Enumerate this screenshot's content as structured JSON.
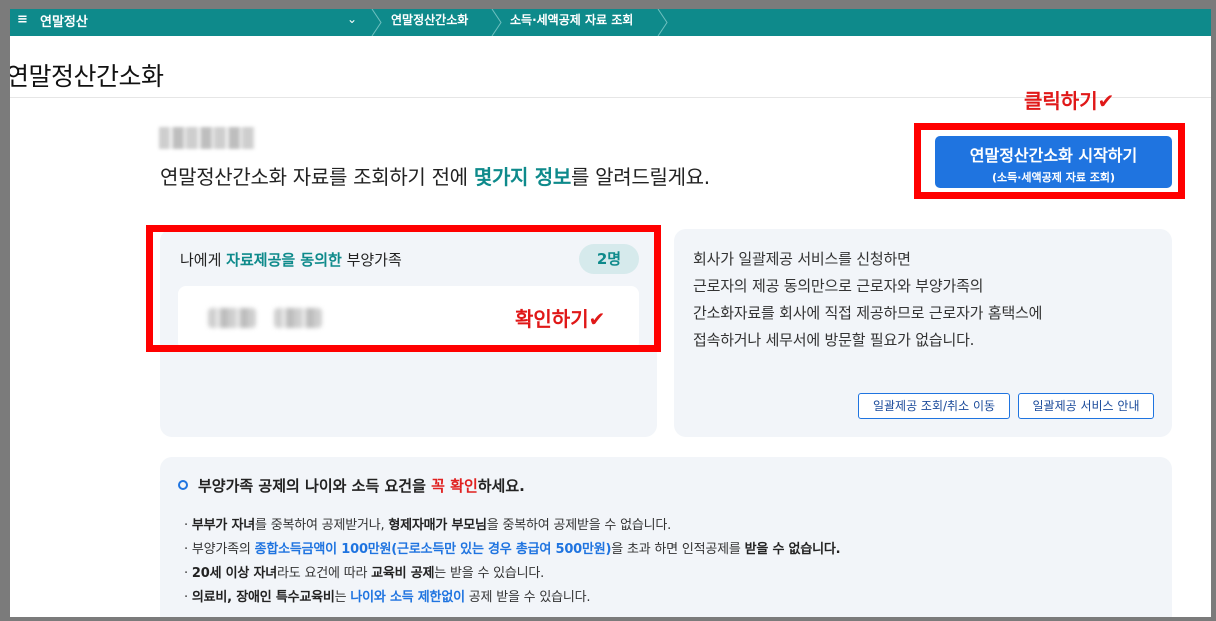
{
  "topbar": {
    "menu_icon": "hamburger-icon",
    "menu_glyph": "≡",
    "title": "연말정산",
    "chevron_glyph": "⌄",
    "breadcrumb": [
      "연말정산간소화",
      "소득·세액공제 자료 조회"
    ]
  },
  "page_title": "연말정산간소화",
  "intro": {
    "before": "연말정산간소화 자료를 조회하기 전에 ",
    "highlight": "몇가지 정보",
    "after": "를 알려드릴게요."
  },
  "annotations": {
    "click": "클릭하기✔",
    "confirm": "확인하기✔",
    "color": "#ff0000"
  },
  "start_button": {
    "line1": "연말정산간소화 시작하기",
    "line2": "(소득·세액공제 자료 조회)"
  },
  "dependents": {
    "title_before": "나에게 ",
    "title_highlight": "자료제공을 동의한",
    "title_after": " 부양가족",
    "count": "2명"
  },
  "info": {
    "lines": [
      "회사가 일괄제공 서비스를 신청하면",
      "근로자의 제공 동의만으로 근로자와 부양가족의",
      "간소화자료를 회사에 직접 제공하므로 근로자가 홈택스에",
      "접속하거나 세무서에 방문할 필요가 없습니다."
    ],
    "btn_lookup": "일괄제공 조회/취소 이동",
    "btn_guide": "일괄제공 서비스 안내"
  },
  "requirements": {
    "title_before": "부양가족 공제의 나이와 소득 요건을 ",
    "title_highlight": "꼭 확인",
    "title_after": "하세요.",
    "l1": {
      "b1": "부부가 자녀",
      "t1": "를 중복하여 공제받거나, ",
      "b2": "형제자매가 부모님",
      "t2": "을 중복하여 공제받을 수 없습니다."
    },
    "l2": {
      "t1": "부양가족의 ",
      "bl1": "종합소득금액이 100만원(근로소득만 있는 경우 총급여 500만원)",
      "t2": "을 초과 하면 인적공제를 ",
      "b1": "받을 수 없습니다."
    },
    "l3": {
      "b1": "20세 이상 자녀",
      "t1": "라도 요건에 따라 ",
      "b2": "교육비 공제",
      "t2": "는 받을 수 있습니다."
    },
    "l4": {
      "b1": "의료비, 장애인 특수교육비",
      "t1": "는 ",
      "bl1": "나이와 소득 제한없이",
      "t2": " 공제 받을 수 있습니다."
    }
  },
  "colors": {
    "brand_teal": "#0e8a8b",
    "primary_blue": "#1f74e0",
    "alert_red": "#e02020"
  }
}
